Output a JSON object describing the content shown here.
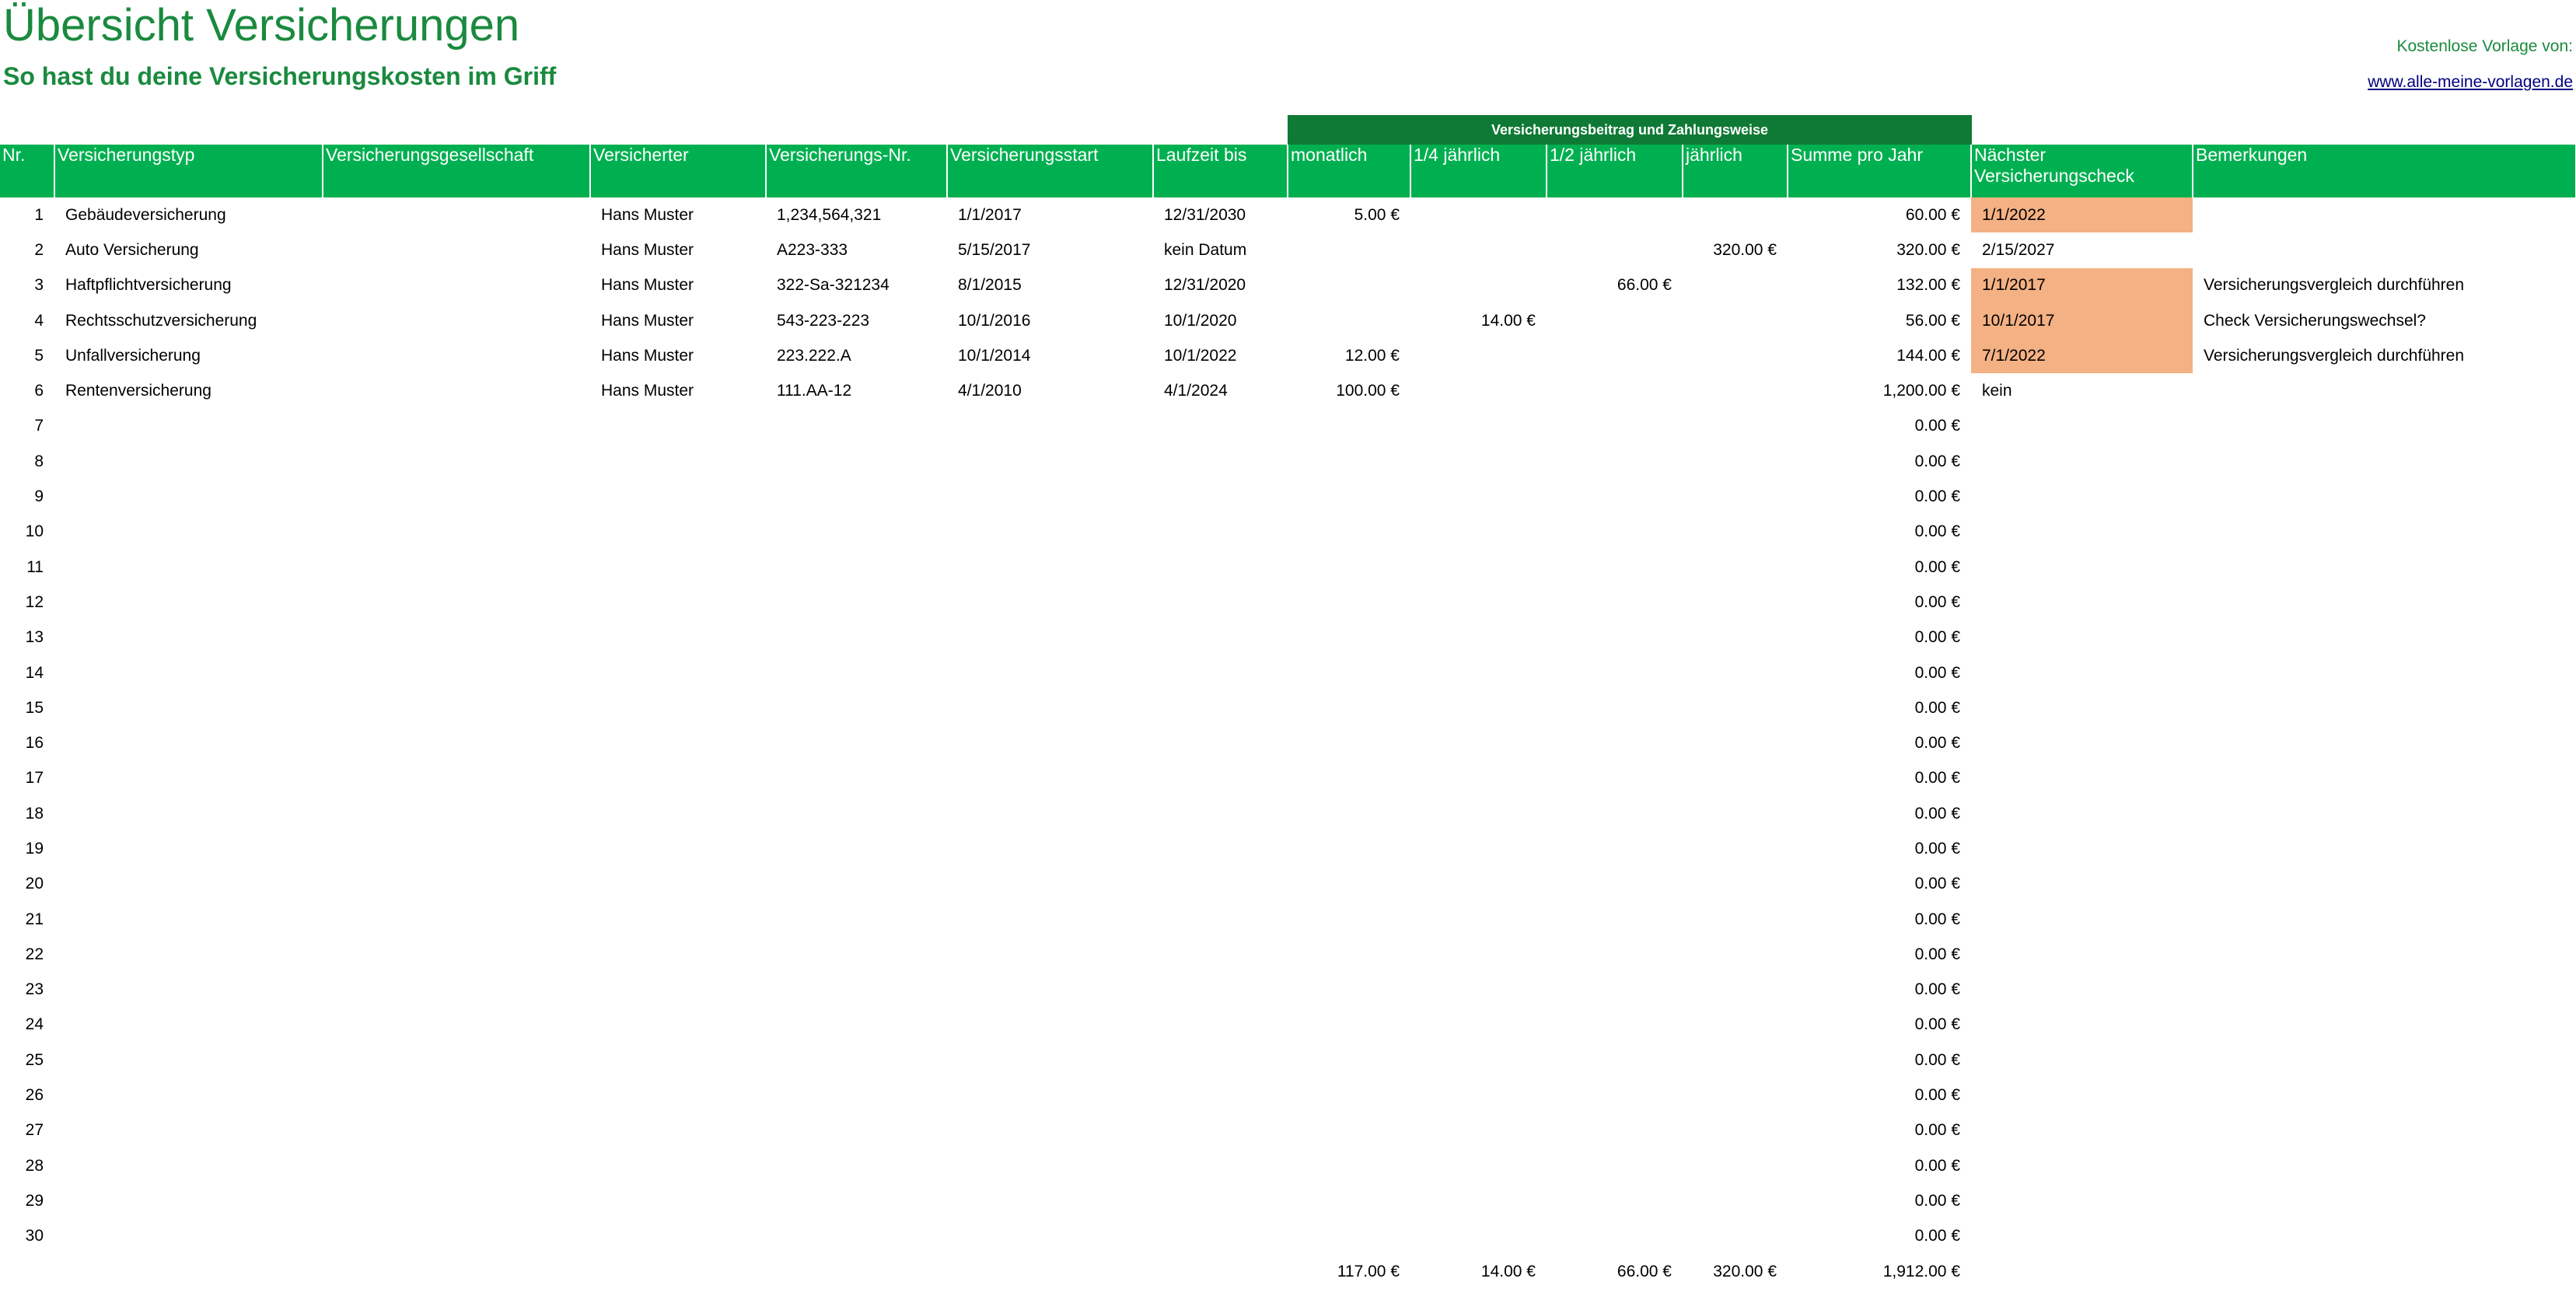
{
  "title": "Übersicht Versicherungen",
  "subtitle": "So hast du deine Versicherungskosten im Griff",
  "credit": {
    "label": "Kostenlose Vorlage von:",
    "link": "www.alle-meine-vorlagen.de"
  },
  "group_header": "Versicherungsbeitrag und Zahlungsweise",
  "colors": {
    "header_bg": "#00b050",
    "group_bg": "#0f7a35",
    "highlight": "#f4b183",
    "title": "#1a8a3e"
  },
  "columns": [
    "Nr.",
    "Versicherungstyp",
    "Versicherungsgesellschaft",
    "Versicherter",
    "Versicherungs-Nr.",
    "Versicherungsstart",
    "Laufzeit bis",
    "monatlich",
    "1/4 jährlich",
    "1/2 jährlich",
    "jährlich",
    "Summe pro Jahr",
    "Nächster Versicherungscheck",
    "Bemerkungen"
  ],
  "rows": [
    {
      "nr": "1",
      "typ": "Gebäudeversicherung",
      "gesellschaft": "",
      "versicherter": "Hans Muster",
      "vnr": "1,234,564,321",
      "start": "1/1/2017",
      "laufzeit": "12/31/2030",
      "monatlich": "5.00 €",
      "viertel": "",
      "halb": "",
      "jaehrlich": "",
      "summe": "60.00 €",
      "check": "1/1/2022",
      "highlight": true,
      "bemerkung": ""
    },
    {
      "nr": "2",
      "typ": "Auto Versicherung",
      "gesellschaft": "",
      "versicherter": "Hans Muster",
      "vnr": "A223-333",
      "start": "5/15/2017",
      "laufzeit": "kein Datum",
      "monatlich": "",
      "viertel": "",
      "halb": "",
      "jaehrlich": "320.00 €",
      "summe": "320.00 €",
      "check": "2/15/2027",
      "highlight": false,
      "bemerkung": ""
    },
    {
      "nr": "3",
      "typ": "Haftpflichtversicherung",
      "gesellschaft": "",
      "versicherter": "Hans Muster",
      "vnr": "322-Sa-321234",
      "start": "8/1/2015",
      "laufzeit": "12/31/2020",
      "monatlich": "",
      "viertel": "",
      "halb": "66.00 €",
      "jaehrlich": "",
      "summe": "132.00 €",
      "check": "1/1/2017",
      "highlight": true,
      "bemerkung": "Versicherungsvergleich durchführen"
    },
    {
      "nr": "4",
      "typ": "Rechtsschutzversicherung",
      "gesellschaft": "",
      "versicherter": "Hans Muster",
      "vnr": "543-223-223",
      "start": "10/1/2016",
      "laufzeit": "10/1/2020",
      "monatlich": "",
      "viertel": "14.00 €",
      "halb": "",
      "jaehrlich": "",
      "summe": "56.00 €",
      "check": "10/1/2017",
      "highlight": true,
      "bemerkung": "Check Versicherungswechsel?"
    },
    {
      "nr": "5",
      "typ": "Unfallversicherung",
      "gesellschaft": "",
      "versicherter": "Hans Muster",
      "vnr": "223.222.A",
      "start": "10/1/2014",
      "laufzeit": "10/1/2022",
      "monatlich": "12.00 €",
      "viertel": "",
      "halb": "",
      "jaehrlich": "",
      "summe": "144.00 €",
      "check": "7/1/2022",
      "highlight": true,
      "bemerkung": "Versicherungsvergleich durchführen"
    },
    {
      "nr": "6",
      "typ": "Rentenversicherung",
      "gesellschaft": "",
      "versicherter": "Hans Muster",
      "vnr": "111.AA-12",
      "start": "4/1/2010",
      "laufzeit": "4/1/2024",
      "monatlich": "100.00 €",
      "viertel": "",
      "halb": "",
      "jaehrlich": "",
      "summe": "1,200.00 €",
      "check": "kein",
      "highlight": false,
      "bemerkung": ""
    },
    {
      "nr": "7",
      "summe": "0.00 €"
    },
    {
      "nr": "8",
      "summe": "0.00 €"
    },
    {
      "nr": "9",
      "summe": "0.00 €"
    },
    {
      "nr": "10",
      "summe": "0.00 €"
    },
    {
      "nr": "11",
      "summe": "0.00 €"
    },
    {
      "nr": "12",
      "summe": "0.00 €"
    },
    {
      "nr": "13",
      "summe": "0.00 €"
    },
    {
      "nr": "14",
      "summe": "0.00 €"
    },
    {
      "nr": "15",
      "summe": "0.00 €"
    },
    {
      "nr": "16",
      "summe": "0.00 €"
    },
    {
      "nr": "17",
      "summe": "0.00 €"
    },
    {
      "nr": "18",
      "summe": "0.00 €"
    },
    {
      "nr": "19",
      "summe": "0.00 €"
    },
    {
      "nr": "20",
      "summe": "0.00 €"
    },
    {
      "nr": "21",
      "summe": "0.00 €"
    },
    {
      "nr": "22",
      "summe": "0.00 €"
    },
    {
      "nr": "23",
      "summe": "0.00 €"
    },
    {
      "nr": "24",
      "summe": "0.00 €"
    },
    {
      "nr": "25",
      "summe": "0.00 €"
    },
    {
      "nr": "26",
      "summe": "0.00 €"
    },
    {
      "nr": "27",
      "summe": "0.00 €"
    },
    {
      "nr": "28",
      "summe": "0.00 €"
    },
    {
      "nr": "29",
      "summe": "0.00 €"
    },
    {
      "nr": "30",
      "summe": "0.00 €"
    }
  ],
  "totals": {
    "monatlich": "117.00 €",
    "viertel": "14.00 €",
    "halb": "66.00 €",
    "jaehrlich": "320.00 €",
    "summe": "1,912.00 €"
  }
}
